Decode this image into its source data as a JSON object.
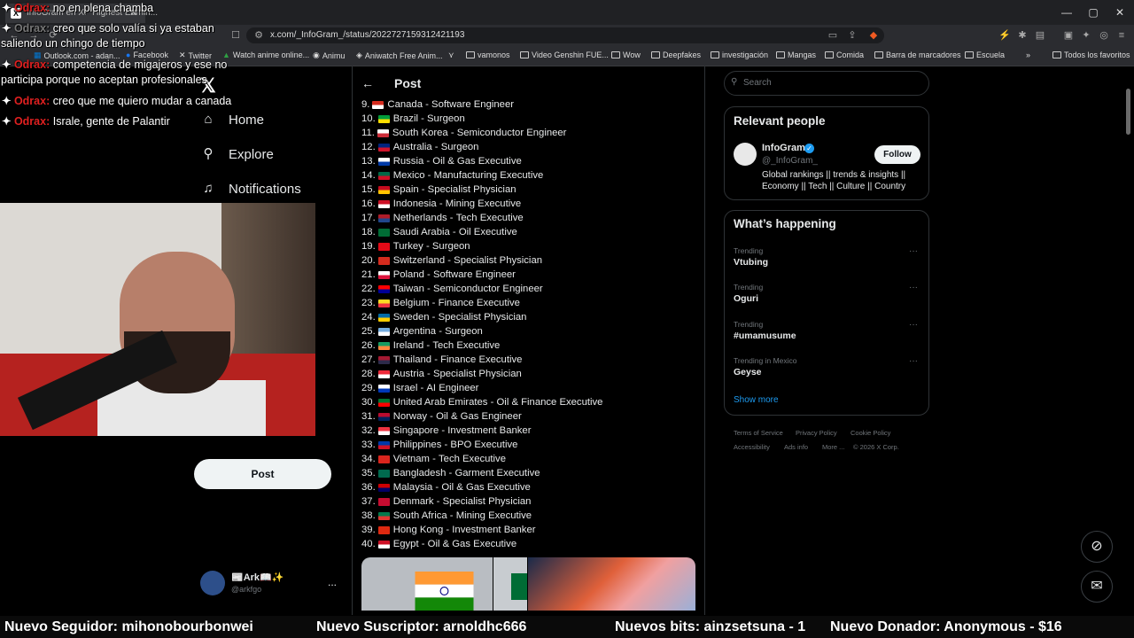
{
  "browser": {
    "tab_title": "InfoGram en X: \"Highest Earnin...",
    "url": "x.com/_InfoGram_/status/2022727159312421193",
    "bookmarks": [
      "Outlook.com - adan...",
      "Facebook",
      "Twitter",
      "Watch anime online...",
      "Animu",
      "Aniwatch Free Anim...",
      "vamonos",
      "Video Genshin FUE...",
      "Wow",
      "Deepfakes",
      "investigación",
      "Mangas",
      "Comida",
      "Barra de marcadores",
      "Escuela"
    ],
    "all_bookmarks": "Todos los favoritos"
  },
  "nav": {
    "home": "Home",
    "explore": "Explore",
    "notifications": "Notifications",
    "post_button": "Post",
    "account_name": "📰Ark📖✨",
    "account_handle": "@arkfgo",
    "more": "..."
  },
  "post": {
    "title": "Post",
    "rankings": [
      {
        "n": "9.",
        "country": "Canada",
        "job": "Software Engineer",
        "c1": "#d52b1e",
        "c2": "#ffffff"
      },
      {
        "n": "10.",
        "country": "Brazil",
        "job": "Surgeon",
        "c1": "#009c3b",
        "c2": "#ffdf00"
      },
      {
        "n": "11.",
        "country": "South Korea",
        "job": "Semiconductor Engineer",
        "c1": "#ffffff",
        "c2": "#cd2e3a"
      },
      {
        "n": "12.",
        "country": "Australia",
        "job": "Surgeon",
        "c1": "#00247d",
        "c2": "#cf142b"
      },
      {
        "n": "13.",
        "country": "Russia",
        "job": "Oil & Gas Executive",
        "c1": "#ffffff",
        "c2": "#0039a6"
      },
      {
        "n": "14.",
        "country": "Mexico",
        "job": "Manufacturing Executive",
        "c1": "#006847",
        "c2": "#ce1126"
      },
      {
        "n": "15.",
        "country": "Spain",
        "job": "Specialist Physician",
        "c1": "#c60b1e",
        "c2": "#ffc400"
      },
      {
        "n": "16.",
        "country": "Indonesia",
        "job": "Mining Executive",
        "c1": "#ce1126",
        "c2": "#ffffff"
      },
      {
        "n": "17.",
        "country": "Netherlands",
        "job": "Tech Executive",
        "c1": "#ae1c28",
        "c2": "#21468b"
      },
      {
        "n": "18.",
        "country": "Saudi Arabia",
        "job": "Oil Executive",
        "c1": "#006c35",
        "c2": "#006c35"
      },
      {
        "n": "19.",
        "country": "Turkey",
        "job": "Surgeon",
        "c1": "#e30a17",
        "c2": "#e30a17"
      },
      {
        "n": "20.",
        "country": "Switzerland",
        "job": "Specialist Physician",
        "c1": "#d52b1e",
        "c2": "#d52b1e"
      },
      {
        "n": "21.",
        "country": "Poland",
        "job": "Software Engineer",
        "c1": "#ffffff",
        "c2": "#dc143c"
      },
      {
        "n": "22.",
        "country": "Taiwan",
        "job": "Semiconductor Engineer",
        "c1": "#fe0000",
        "c2": "#000095"
      },
      {
        "n": "23.",
        "country": "Belgium",
        "job": "Finance Executive",
        "c1": "#fdda24",
        "c2": "#ef3340"
      },
      {
        "n": "24.",
        "country": "Sweden",
        "job": "Specialist Physician",
        "c1": "#006aa7",
        "c2": "#fecc00"
      },
      {
        "n": "25.",
        "country": "Argentina",
        "job": "Surgeon",
        "c1": "#74acdf",
        "c2": "#ffffff"
      },
      {
        "n": "26.",
        "country": "Ireland",
        "job": "Tech Executive",
        "c1": "#169b62",
        "c2": "#ff883e"
      },
      {
        "n": "27.",
        "country": "Thailand",
        "job": "Finance Executive",
        "c1": "#a51931",
        "c2": "#2d2a4a"
      },
      {
        "n": "28.",
        "country": "Austria",
        "job": "Specialist Physician",
        "c1": "#ed2939",
        "c2": "#ffffff"
      },
      {
        "n": "29.",
        "country": "Israel",
        "job": "AI Engineer",
        "c1": "#ffffff",
        "c2": "#0038b8"
      },
      {
        "n": "30.",
        "country": "United Arab Emirates",
        "job": "Oil & Finance Executive",
        "c1": "#00732f",
        "c2": "#ff0000"
      },
      {
        "n": "31.",
        "country": "Norway",
        "job": "Oil & Gas Engineer",
        "c1": "#ba0c2f",
        "c2": "#00205b"
      },
      {
        "n": "32.",
        "country": "Singapore",
        "job": "Investment Banker",
        "c1": "#ef3340",
        "c2": "#ffffff"
      },
      {
        "n": "33.",
        "country": "Philippines",
        "job": "BPO Executive",
        "c1": "#0038a8",
        "c2": "#ce1126"
      },
      {
        "n": "34.",
        "country": "Vietnam",
        "job": "Tech Executive",
        "c1": "#da251d",
        "c2": "#da251d"
      },
      {
        "n": "35.",
        "country": "Bangladesh",
        "job": "Garment Executive",
        "c1": "#006a4e",
        "c2": "#006a4e"
      },
      {
        "n": "36.",
        "country": "Malaysia",
        "job": "Oil & Gas Executive",
        "c1": "#cc0001",
        "c2": "#010066"
      },
      {
        "n": "37.",
        "country": "Denmark",
        "job": "Specialist Physician",
        "c1": "#c60c30",
        "c2": "#c60c30"
      },
      {
        "n": "38.",
        "country": "South Africa",
        "job": "Mining Executive",
        "c1": "#007a4d",
        "c2": "#de3831"
      },
      {
        "n": "39.",
        "country": "Hong Kong",
        "job": "Investment Banker",
        "c1": "#de2910",
        "c2": "#de2910"
      },
      {
        "n": "40.",
        "country": "Egypt",
        "job": "Oil & Gas Executive",
        "c1": "#ce1126",
        "c2": "#ffffff"
      }
    ],
    "separator": " - "
  },
  "sidebar": {
    "search_placeholder": "Search",
    "relevant_title": "Relevant people",
    "person_name": "InfoGram",
    "person_handle": "@_InfoGram_",
    "person_bio": "Global rankings || trends & insights || Economy || Tech || Culture || Country",
    "follow": "Follow",
    "happening_title": "What’s happening",
    "trends": [
      {
        "label": "Trending",
        "name": "Vtubing"
      },
      {
        "label": "Trending",
        "name": "Oguri"
      },
      {
        "label": "Trending",
        "name": "#umamusume"
      },
      {
        "label": "Trending in Mexico",
        "name": "Geyse"
      }
    ],
    "show_more": "Show more",
    "footer": [
      "Terms of Service",
      "Privacy Policy",
      "Cookie Policy",
      "Accessibility",
      "Ads info",
      "More ...",
      "© 2026 X Corp."
    ]
  },
  "chat": [
    {
      "name": "Odrax",
      "msg": "no en plena chamba"
    },
    {
      "name": "",
      "msg": "creo que solo valía si ya estaban"
    },
    {
      "name": "",
      "msg": "saliendo un chingo de tiempo"
    },
    {
      "name": "Odrax",
      "msg": "competencia de migajeros y ese no"
    },
    {
      "name": "",
      "msg": "participa porque no aceptan profesionales"
    },
    {
      "name": "Odrax",
      "msg": "creo que me quiero mudar a canada"
    },
    {
      "name": "Odrax",
      "msg": "Israle, gente de Palantir"
    }
  ],
  "ticker": {
    "follower": "Nuevo Seguidor: mihonobourbonwei",
    "subscriber": "Nuevo Suscriptor: arnoldhc666",
    "bits": "Nuevos bits: ainzsetsuna - 1",
    "donor": "Nuevo Donador: Anonymous - $16"
  }
}
